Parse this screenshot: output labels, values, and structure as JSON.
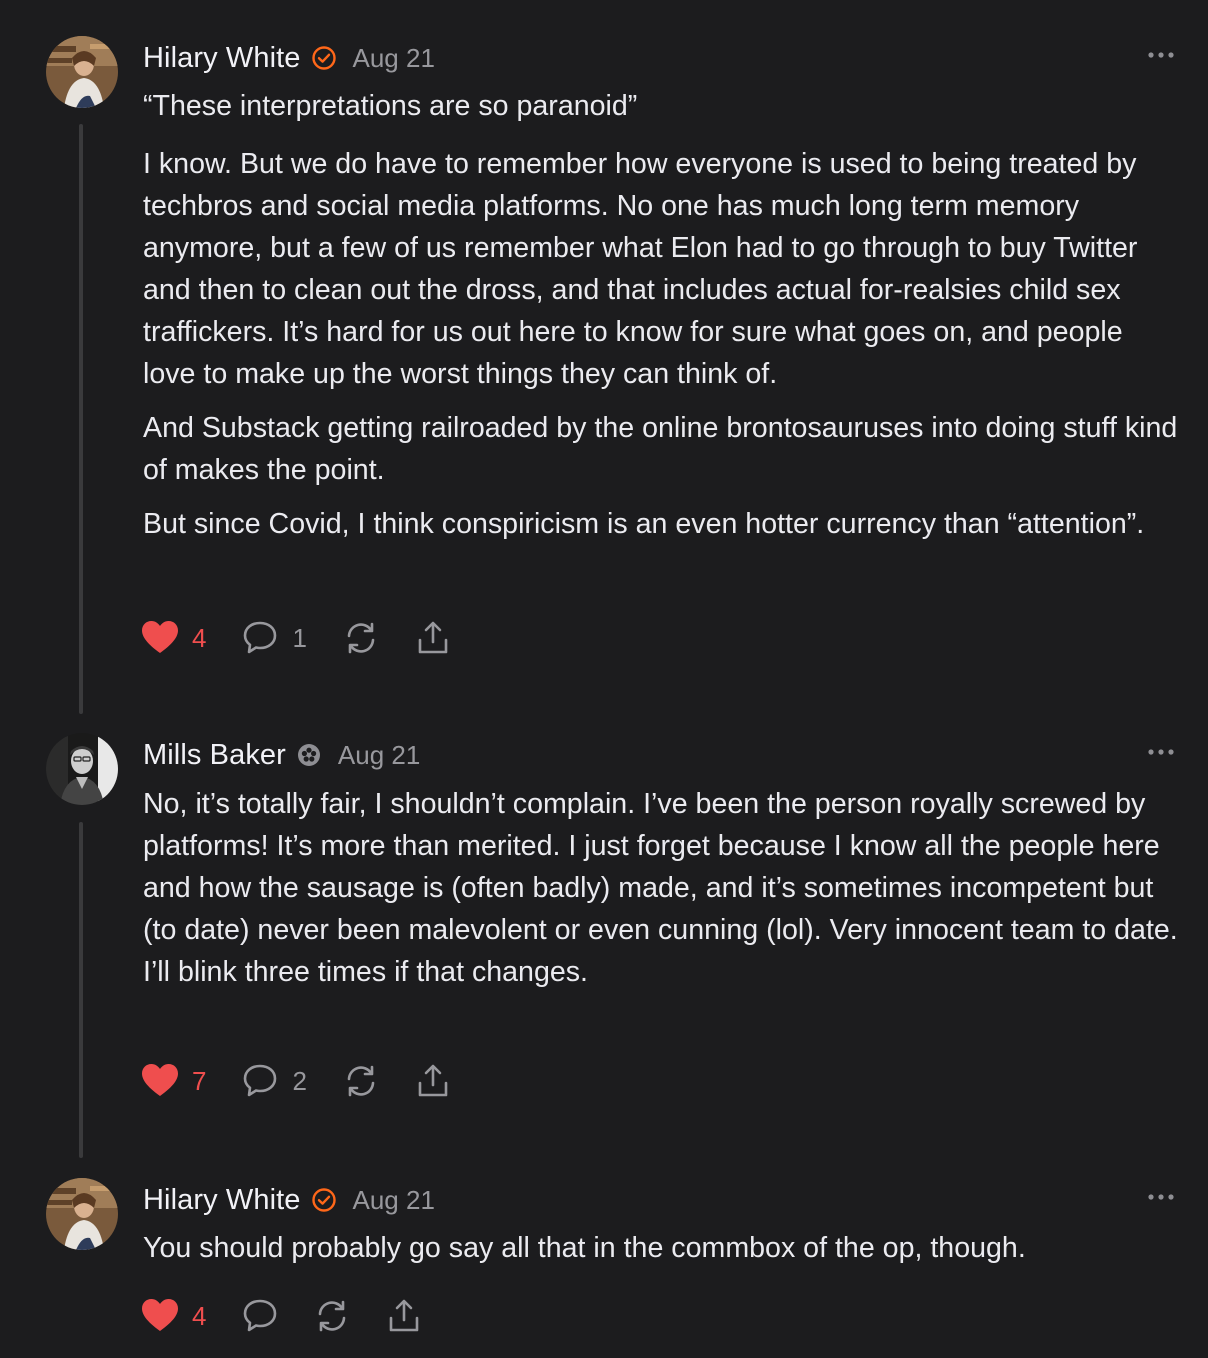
{
  "comments": [
    {
      "author": "Hilary White",
      "date": "Aug 21",
      "badge": "orange-check-badge",
      "paragraphs": [
        "“These interpretations are so paranoid”",
        "I know. But we do have to remember how everyone is used to being treated by techbros and social media platforms. No one has much long term memory anymore, but a few of us remember what Elon had to go through to buy Twitter and then to clean out the dross, and that includes actual for-realsies child sex traffickers. It’s hard for us out here to know for sure what goes on, and people love to make up the worst things they can think of.",
        "And Substack getting railroaded by the online brontosauruses into doing stuff kind of makes the point.",
        "But since Covid, I think conspiricism is an even hotter currency than “attention”."
      ],
      "likes": "4",
      "replies": "1"
    },
    {
      "author": "Mills Baker",
      "date": "Aug 21",
      "badge": "gray-flower-badge",
      "paragraphs": [
        "No, it’s totally fair, I shouldn’t complain. I’ve been the person royally screwed by platforms! It’s more than merited. I just forget because I know all the people here and how the sausage is (often badly) made, and it’s sometimes incompetent but (to date) never been malevolent or even cunning (lol). Very innocent team to date. I’ll blink three times if that changes."
      ],
      "likes": "7",
      "replies": "2"
    },
    {
      "author": "Hilary White",
      "date": "Aug 21",
      "badge": "orange-check-badge",
      "paragraphs": [
        "You should probably go say all that in the commbox of the op, though."
      ],
      "likes": "4",
      "replies": ""
    }
  ],
  "icons": {
    "like": "heart-icon",
    "reply": "comment-bubble-icon",
    "restack": "restack-icon",
    "share": "share-icon",
    "more": "more-options-icon"
  },
  "colors": {
    "background": "#1c1c1e",
    "heart": "#ef4e4e",
    "badge_orange": "#ff6719",
    "muted": "#98989d"
  }
}
